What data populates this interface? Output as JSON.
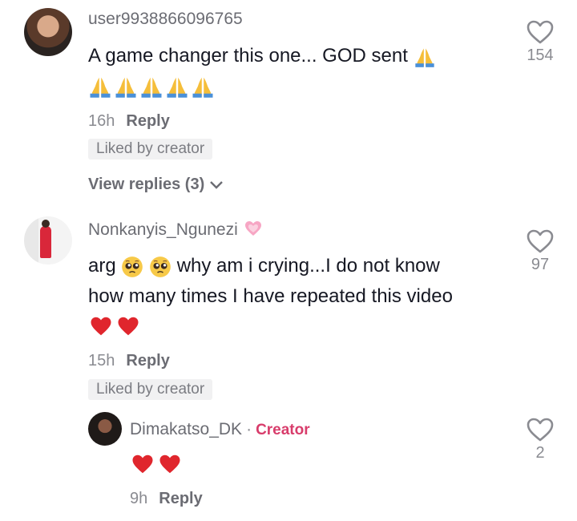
{
  "comments": [
    {
      "username": "user9938866096765",
      "text": "A game changer this one... GOD sent",
      "time": "16h",
      "reply_label": "Reply",
      "liked_badge": "Liked by creator",
      "view_replies": "View replies (3)",
      "likes": "154"
    },
    {
      "username": "Nonkanyis_Ngunezi",
      "text_prefix": "arg",
      "text_line1": "why am i crying...I do not know",
      "text_line2": "how many times I have repeated this video",
      "time": "15h",
      "reply_label": "Reply",
      "liked_badge": "Liked by creator",
      "likes": "97"
    }
  ],
  "reply": {
    "username": "Dimakatso_DK",
    "separator": "·",
    "creator_label": "Creator",
    "time": "9h",
    "reply_label": "Reply",
    "likes": "2"
  },
  "colors": {
    "creator": "#d83c6b",
    "heart_emoji": "#e0262d",
    "pray_emoji": "#f2b321"
  },
  "icons": [
    "heart-outline-icon",
    "folded-hands-emoji",
    "pleading-face-emoji",
    "red-heart-emoji",
    "pink-heart-emoji",
    "chevron-down-icon"
  ]
}
